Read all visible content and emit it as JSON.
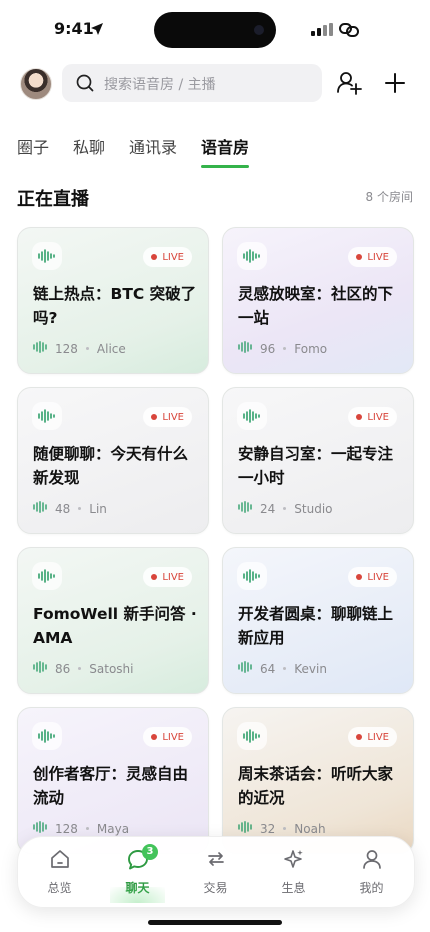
{
  "status_bar": {
    "time": "9:41"
  },
  "header": {
    "search_placeholder": "搜索语音房 / 主播"
  },
  "tabs": [
    {
      "label": "圈子",
      "active": false
    },
    {
      "label": "私聊",
      "active": false
    },
    {
      "label": "通讯录",
      "active": false
    },
    {
      "label": "语音房",
      "active": true
    }
  ],
  "section": {
    "title": "正在直播",
    "count": "8 个房间"
  },
  "rooms": [
    {
      "title": "链上热点：BTC 突破了吗?",
      "listeners": "128",
      "host": "Alice",
      "live": "LIVE"
    },
    {
      "title": "灵感放映室：社区的下一站",
      "listeners": "96",
      "host": "Fomo",
      "live": "LIVE"
    },
    {
      "title": "随便聊聊：今天有什么新发现",
      "listeners": "48",
      "host": "Lin",
      "live": "LIVE"
    },
    {
      "title": "安静自习室：一起专注一小时",
      "listeners": "24",
      "host": "Studio",
      "live": "LIVE"
    },
    {
      "title": "FomoWell 新手问答 · AMA",
      "listeners": "86",
      "host": "Satoshi",
      "live": "LIVE"
    },
    {
      "title": "开发者圆桌：聊聊链上新应用",
      "listeners": "64",
      "host": "Kevin",
      "live": "LIVE"
    },
    {
      "title": "创作者客厅：灵感自由流动",
      "listeners": "128",
      "host": "Maya",
      "live": "LIVE"
    },
    {
      "title": "周末茶话会：听听大家的近况",
      "listeners": "32",
      "host": "Noah",
      "live": "LIVE"
    }
  ],
  "bottom_nav": [
    {
      "label": "总览",
      "icon": "home-icon"
    },
    {
      "label": "聊天",
      "icon": "chat-icon",
      "badge": "3",
      "active": true
    },
    {
      "label": "交易",
      "icon": "swap-icon"
    },
    {
      "label": "生息",
      "icon": "sparkle-icon"
    },
    {
      "label": "我的",
      "icon": "person-icon"
    }
  ],
  "colors": {
    "accent": "#34b34a",
    "live_red": "#d8453b",
    "wave_green": "#2f9f6a"
  }
}
